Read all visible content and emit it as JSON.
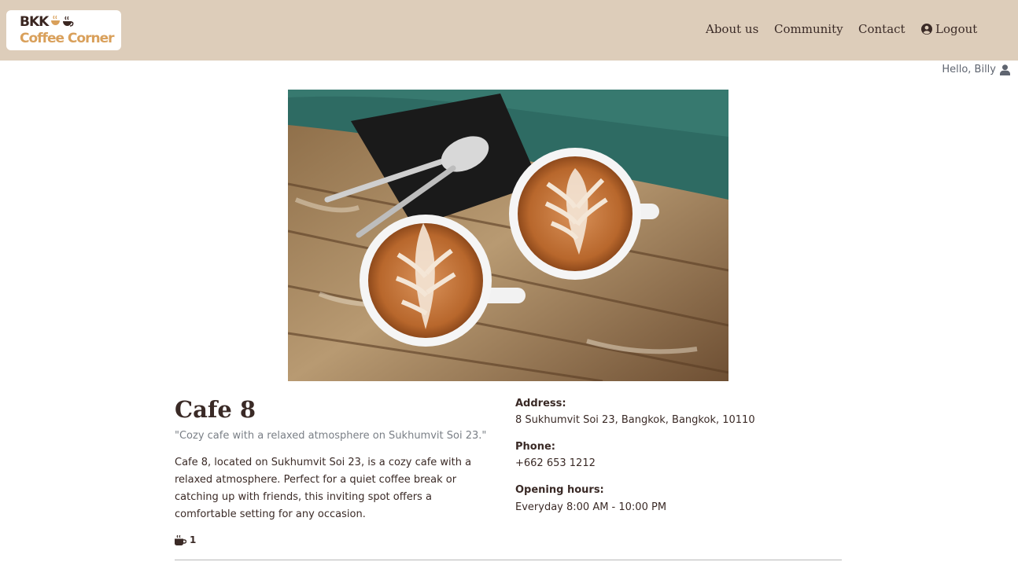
{
  "brand": {
    "line1": "BKK",
    "line2": "Coffee Corner",
    "primary_color": "#3a2621",
    "accent_color": "#d9a05b",
    "header_bg": "#ddcdba"
  },
  "nav": {
    "about": "About us",
    "community": "Community",
    "contact": "Contact",
    "logout": "Logout",
    "logout_icon": "user-circle-icon"
  },
  "user": {
    "greeting": "Hello, Billy",
    "icon": "user-icon"
  },
  "cafe": {
    "photo_subject": "two cups of latte art on a rustic wooden table",
    "name": "Cafe 8",
    "tagline": "\"Cozy cafe with a relaxed atmosphere on Sukhumvit Soi 23.\"",
    "description": "Cafe 8, located on Sukhumvit Soi 23, is a cozy cafe with a relaxed atmosphere. Perfect for a quiet coffee break or catching up with friends, this inviting spot offers a comfortable setting for any occasion.",
    "likes_icon": "mug-icon",
    "likes_count": "1",
    "address_label": "Address:",
    "address": "8 Sukhumvit Soi 23, Bangkok, Bangkok, 10110",
    "phone_label": "Phone:",
    "phone": "+662 653 1212",
    "hours_label": "Opening hours:",
    "hours": "Everyday 8:00 AM - 10:00 PM"
  }
}
